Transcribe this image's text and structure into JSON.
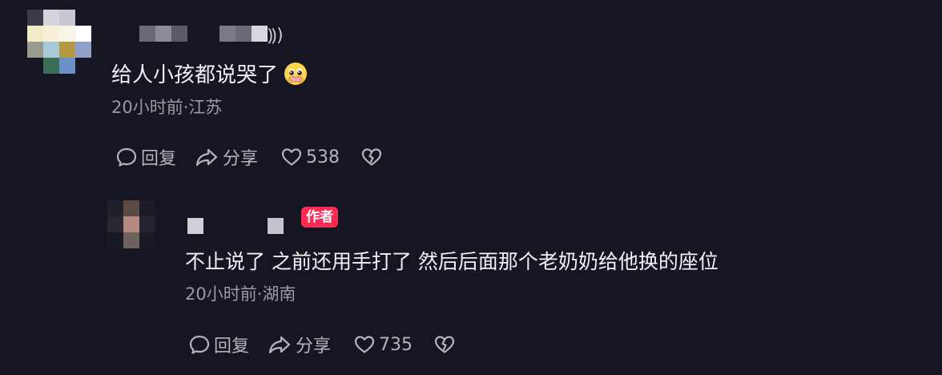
{
  "comments": [
    {
      "username_tail": "⸩)",
      "text": "给人小孩都说哭了",
      "emoji": "pleading-face-emoji",
      "meta": "20小时前·江苏",
      "actions": {
        "reply_label": "回复",
        "share_label": "分享",
        "like_count": "538"
      }
    },
    {
      "badge": "作者",
      "text": "不止说了 之前还用手打了 然后后面那个老奶奶给他换的座位",
      "meta": "20小时前·湖南",
      "actions": {
        "reply_label": "回复",
        "share_label": "分享",
        "like_count": "735"
      }
    }
  ],
  "colors": {
    "background": "#161622",
    "author_badge": "#fe2c55",
    "text_primary": "#f1f1f4",
    "text_secondary": "#9a9aa4"
  },
  "icons": [
    "comment-bubble-icon",
    "share-arrow-icon",
    "heart-icon",
    "broken-heart-icon"
  ]
}
